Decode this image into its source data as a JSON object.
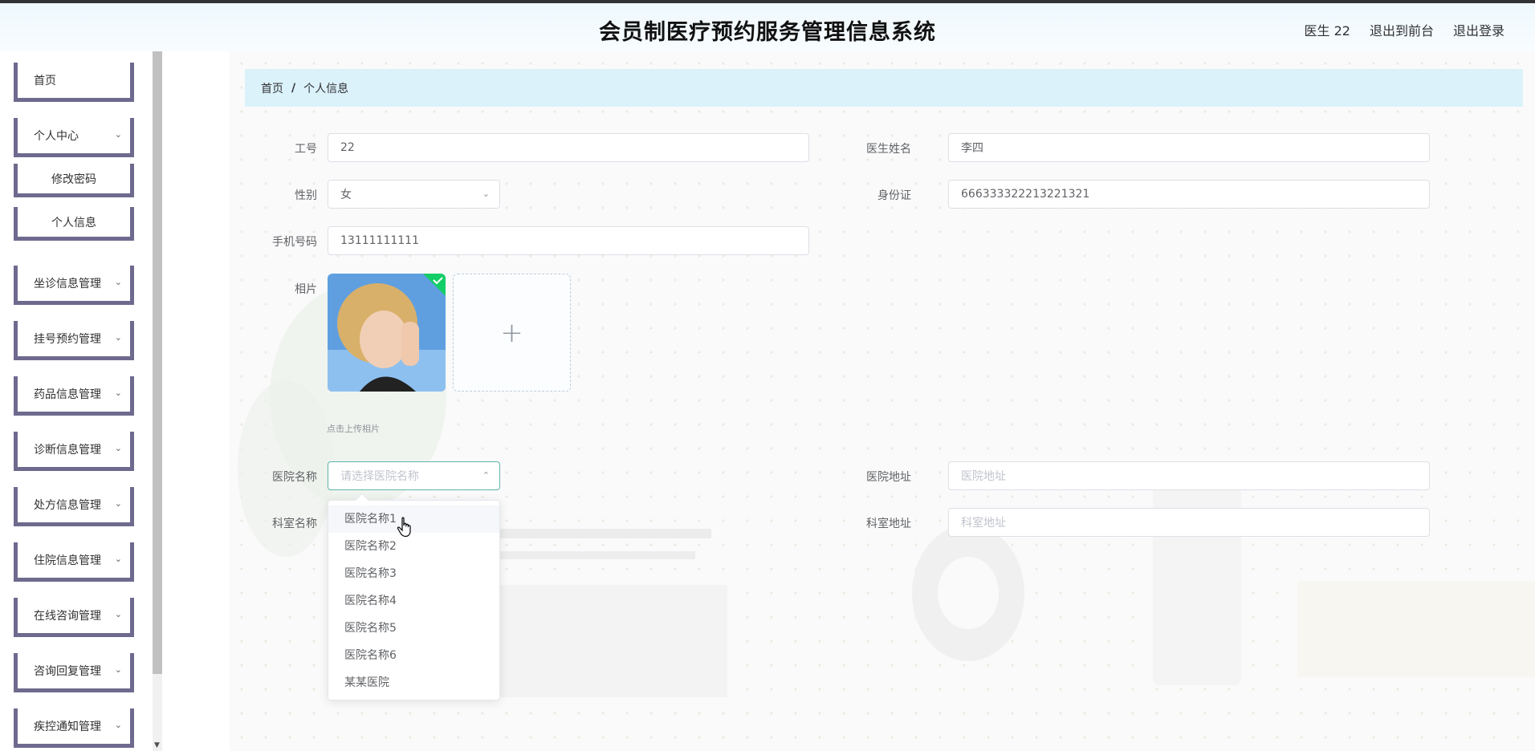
{
  "header": {
    "title": "会员制医疗预约服务管理信息系统",
    "user": "医生 22",
    "back_to_front": "退出到前台",
    "logout": "退出登录"
  },
  "sidebar": {
    "items": [
      {
        "label": "首页"
      },
      {
        "label": "个人中心"
      },
      {
        "label": "修改密码"
      },
      {
        "label": "个人信息"
      },
      {
        "label": "坐诊信息管理"
      },
      {
        "label": "挂号预约管理"
      },
      {
        "label": "药品信息管理"
      },
      {
        "label": "诊断信息管理"
      },
      {
        "label": "处方信息管理"
      },
      {
        "label": "住院信息管理"
      },
      {
        "label": "在线咨询管理"
      },
      {
        "label": "咨询回复管理"
      },
      {
        "label": "疾控通知管理"
      }
    ]
  },
  "breadcrumb": {
    "home": "首页",
    "separator": "/",
    "current": "个人信息"
  },
  "form": {
    "job_no": {
      "label": "工号",
      "value": "22"
    },
    "doctor_name": {
      "label": "医生姓名",
      "value": "李四"
    },
    "gender": {
      "label": "性别",
      "value": "女"
    },
    "id_card": {
      "label": "身份证",
      "value": "666333322213221321"
    },
    "phone": {
      "label": "手机号码",
      "value": "13111111111"
    },
    "photo": {
      "label": "相片",
      "upload_plus": "+",
      "hint": "点击上传相片"
    },
    "hospital_name": {
      "label": "医院名称",
      "placeholder": "请选择医院名称"
    },
    "hospital_address": {
      "label": "医院地址",
      "placeholder": "医院地址"
    },
    "dept_name": {
      "label": "科室名称"
    },
    "dept_address": {
      "label": "科室地址",
      "placeholder": "科室地址"
    }
  },
  "hospital_dropdown": {
    "options": [
      "医院名称1",
      "医院名称2",
      "医院名称3",
      "医院名称4",
      "医院名称5",
      "医院名称6",
      "某某医院"
    ],
    "hovered_index": 0
  },
  "colors": {
    "sidebar_border": "#6e6a8e",
    "breadcrumb_bg": "#dbf2fb",
    "focus_border": "#5cb6a8",
    "success_badge": "#13ce66"
  }
}
